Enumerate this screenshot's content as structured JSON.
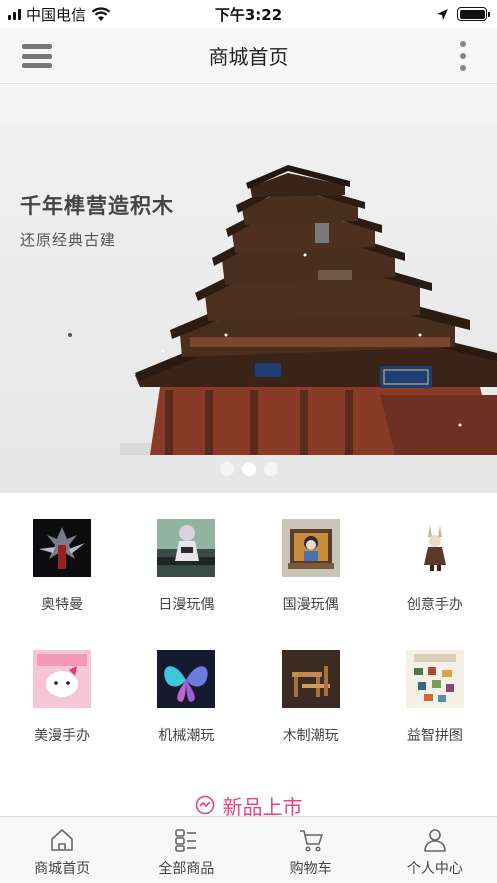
{
  "status_bar": {
    "carrier": "中国电信",
    "time": "下午3:22",
    "icons": [
      "signal-icon",
      "wifi-icon",
      "location-arrow-icon",
      "battery-icon"
    ]
  },
  "nav": {
    "title": "商城首页",
    "left_icon": "menu-icon",
    "right_icon": "more-vertical-icon"
  },
  "banner": {
    "title": "千年榫营造积木",
    "subtitle": "还原经典古建",
    "slide_count": 3,
    "active_slide": 1
  },
  "categories": [
    {
      "label": "奥特曼"
    },
    {
      "label": "日漫玩偶"
    },
    {
      "label": "国漫玩偶"
    },
    {
      "label": "创意手办"
    },
    {
      "label": "美漫手办"
    },
    {
      "label": "机械潮玩"
    },
    {
      "label": "木制潮玩"
    },
    {
      "label": "益智拼图"
    }
  ],
  "new_arrivals": {
    "title": "新品上市",
    "icon": "new-arrivals-icon",
    "accent_color": "#e8437f"
  },
  "tab_bar": {
    "tabs": [
      {
        "label": "商城首页",
        "icon": "home-icon"
      },
      {
        "label": "全部商品",
        "icon": "list-icon"
      },
      {
        "label": "购物车",
        "icon": "cart-icon"
      },
      {
        "label": "个人中心",
        "icon": "user-icon"
      }
    ]
  }
}
